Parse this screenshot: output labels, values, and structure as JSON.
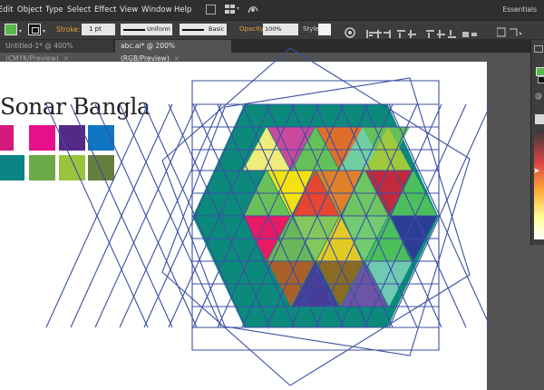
{
  "menubar": {
    "items": [
      "Edit",
      "Object",
      "Type",
      "Select",
      "Effect",
      "View",
      "Window",
      "Help"
    ],
    "workspace": "Essentials"
  },
  "control_bar": {
    "stroke_label": "Stroke:",
    "stroke_weight": "1 pt",
    "profile": "Uniform",
    "brush": "Basic",
    "opacity_label": "Opacity:",
    "opacity_value": "100%",
    "style_label": "Style:",
    "fill_color": "#59b84c"
  },
  "tabs": [
    {
      "label": "Untitled-1* @ 400% (CMYK/Preview)",
      "active": false
    },
    {
      "label": "abc.ai* @ 200% (RGB/Preview)",
      "active": true
    }
  ],
  "artboard": {
    "title": "Sonar Bangla",
    "swatches_row1": [
      "#d4187e",
      "#e8108a",
      "#552a86",
      "#0f76c3"
    ],
    "swatches_row2": [
      "#0b8583",
      "#6cab45",
      "#99c43c",
      "#657f3c"
    ]
  },
  "artwork": {
    "outline_color": "#3b4fa3",
    "hex_color": "#0b8a7c",
    "triangle_colors": {
      "up_row1": [
        "#efec7c",
        "#6fcfa3",
        "#9fc83c"
      ],
      "down_row1": [
        "#c94a9c",
        "#de6f2a",
        "#66c05a"
      ],
      "up_row2": [
        "#6ac058",
        "#e6452f",
        "#6fc562",
        "#4cbe5b"
      ],
      "down_row2": [
        "#f4e112",
        "#e08129",
        "#c02a3c"
      ],
      "up_row3": [
        "#e71a66",
        "#74c45b",
        "#e2ca25",
        "#2c3d96"
      ],
      "down_row3": [
        "#6ab65a",
        "#84c75c",
        "#72cb72"
      ],
      "up_row4": [
        "#453d97",
        "#6e54a5"
      ],
      "down_row4": [
        "#ab6027",
        "#8b6a22",
        "#70c9b3"
      ]
    }
  }
}
